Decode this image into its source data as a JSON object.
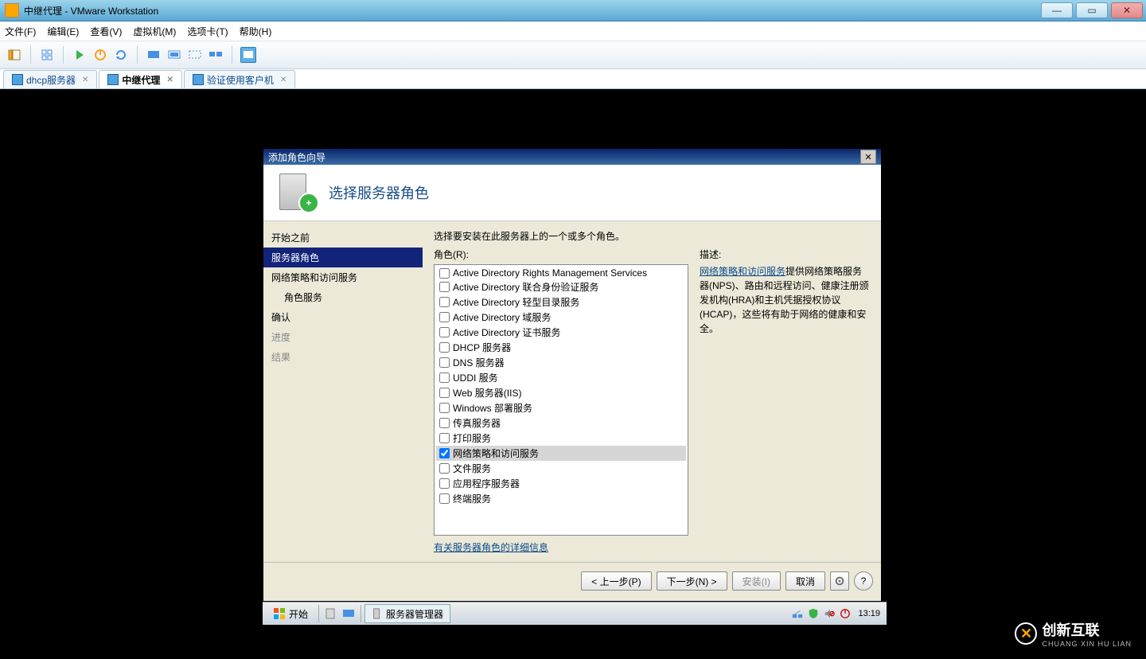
{
  "app": {
    "title": "中继代理 - VMware Workstation",
    "menus": [
      "文件(F)",
      "编辑(E)",
      "查看(V)",
      "虚拟机(M)",
      "选项卡(T)",
      "帮助(H)"
    ],
    "tabs": [
      {
        "label": "dhcp服务器",
        "active": false
      },
      {
        "label": "中继代理",
        "active": true
      },
      {
        "label": "验证使用客户机",
        "active": false
      }
    ]
  },
  "dialog": {
    "window_title": "添加角色向导",
    "heading": "选择服务器角色",
    "instruction": "选择要安装在此服务器上的一个或多个角色。",
    "roles_label": "角色(R):",
    "roles": [
      {
        "label": "Active Directory Rights Management Services",
        "checked": false
      },
      {
        "label": "Active Directory 联合身份验证服务",
        "checked": false
      },
      {
        "label": "Active Directory 轻型目录服务",
        "checked": false
      },
      {
        "label": "Active Directory 域服务",
        "checked": false
      },
      {
        "label": "Active Directory 证书服务",
        "checked": false
      },
      {
        "label": "DHCP 服务器",
        "checked": false
      },
      {
        "label": "DNS 服务器",
        "checked": false
      },
      {
        "label": "UDDI 服务",
        "checked": false
      },
      {
        "label": "Web 服务器(IIS)",
        "checked": false
      },
      {
        "label": "Windows 部署服务",
        "checked": false
      },
      {
        "label": "传真服务器",
        "checked": false
      },
      {
        "label": "打印服务",
        "checked": false
      },
      {
        "label": "网络策略和访问服务",
        "checked": true
      },
      {
        "label": "文件服务",
        "checked": false
      },
      {
        "label": "应用程序服务器",
        "checked": false
      },
      {
        "label": "终端服务",
        "checked": false
      }
    ],
    "roles_link": "有关服务器角色的详细信息",
    "desc_heading": "描述:",
    "desc_link": "网络策略和访问服务",
    "desc_text": "提供网络策略服务器(NPS)、路由和远程访问、健康注册颁发机构(HRA)和主机凭据授权协议(HCAP)，这些将有助于网络的健康和安全。",
    "steps": [
      {
        "label": "开始之前",
        "state": "normal"
      },
      {
        "label": "服务器角色",
        "state": "selected"
      },
      {
        "label": "网络策略和访问服务",
        "state": "normal"
      },
      {
        "label": "角色服务",
        "state": "sub"
      },
      {
        "label": "确认",
        "state": "normal"
      },
      {
        "label": "进度",
        "state": "disabled"
      },
      {
        "label": "结果",
        "state": "disabled"
      }
    ],
    "buttons": {
      "prev": "< 上一步(P)",
      "next": "下一步(N) >",
      "install": "安装(I)",
      "cancel": "取消"
    }
  },
  "taskbar": {
    "start": "开始",
    "active_app": "服务器管理器",
    "clock": "13:19"
  },
  "watermark": {
    "brand": "创新互联",
    "sub": "CHUANG XIN HU LIAN"
  }
}
